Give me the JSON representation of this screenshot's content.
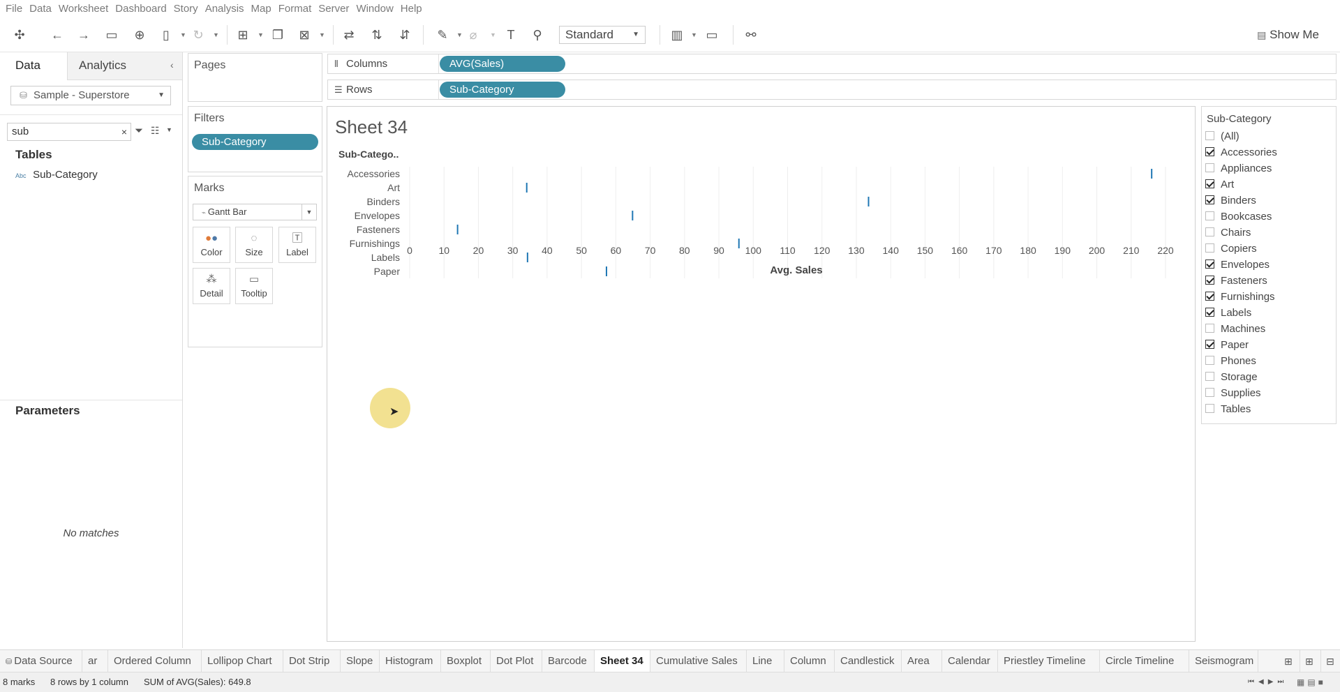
{
  "menu": [
    "File",
    "Data",
    "Worksheet",
    "Dashboard",
    "Story",
    "Analysis",
    "Map",
    "Format",
    "Server",
    "Window",
    "Help"
  ],
  "toolbar": {
    "fit": "Standard",
    "show_me": "Show Me"
  },
  "left_pane": {
    "tabs": [
      "Data",
      "Analytics"
    ],
    "datasource": "Sample - Superstore",
    "search_value": "sub",
    "tables_heading": "Tables",
    "fields": [
      {
        "type": "Abc",
        "name": "Sub-Category"
      }
    ],
    "parameters_heading": "Parameters",
    "no_matches": "No matches"
  },
  "cards": {
    "pages": "Pages",
    "filters": "Filters",
    "filter_pill": "Sub-Category",
    "marks": "Marks",
    "mark_type": "Gantt Bar",
    "mark_buttons": [
      "Color",
      "Size",
      "Label",
      "Detail",
      "Tooltip"
    ]
  },
  "shelves": {
    "columns_label": "Columns",
    "columns_pill": "AVG(Sales)",
    "rows_label": "Rows",
    "rows_pill": "Sub-Category"
  },
  "sheet_title": "Sheet 34",
  "chart_data": {
    "type": "gantt",
    "row_header": "Sub-Catego..",
    "categories": [
      "Accessories",
      "Art",
      "Binders",
      "Envelopes",
      "Fasteners",
      "Furnishings",
      "Labels",
      "Paper"
    ],
    "values": [
      215.97,
      34.07,
      133.56,
      64.87,
      13.94,
      95.83,
      34.3,
      57.28
    ],
    "xlabel": "Avg. Sales",
    "xlim": [
      0,
      225
    ],
    "xticks": [
      0,
      10,
      20,
      30,
      40,
      50,
      60,
      70,
      80,
      90,
      100,
      110,
      120,
      130,
      140,
      150,
      160,
      170,
      180,
      190,
      200,
      210,
      220
    ],
    "color": "#1f77b4"
  },
  "legend": {
    "title": "Sub-Category",
    "items": [
      {
        "label": "(All)",
        "checked": false
      },
      {
        "label": "Accessories",
        "checked": true
      },
      {
        "label": "Appliances",
        "checked": false
      },
      {
        "label": "Art",
        "checked": true
      },
      {
        "label": "Binders",
        "checked": true
      },
      {
        "label": "Bookcases",
        "checked": false
      },
      {
        "label": "Chairs",
        "checked": false
      },
      {
        "label": "Copiers",
        "checked": false
      },
      {
        "label": "Envelopes",
        "checked": true
      },
      {
        "label": "Fasteners",
        "checked": true
      },
      {
        "label": "Furnishings",
        "checked": true
      },
      {
        "label": "Labels",
        "checked": true
      },
      {
        "label": "Machines",
        "checked": false
      },
      {
        "label": "Paper",
        "checked": true
      },
      {
        "label": "Phones",
        "checked": false
      },
      {
        "label": "Storage",
        "checked": false
      },
      {
        "label": "Supplies",
        "checked": false
      },
      {
        "label": "Tables",
        "checked": false
      }
    ]
  },
  "tabs": [
    "Data Source",
    "ar",
    "Ordered Column",
    "Lollipop Chart",
    "Dot Strip",
    "Slope",
    "Histogram",
    "Boxplot",
    "Dot Plot",
    "Barcode",
    "Sheet 34",
    "Cumulative Sales",
    "Line",
    "Column",
    "Candlestick",
    "Area",
    "Calendar",
    "Priestley Timeline",
    "Circle Timeline",
    "Seismogram"
  ],
  "active_tab": "Sheet 34",
  "status": {
    "marks": "8 marks",
    "rows": "8 rows by 1 column",
    "sum": "SUM of AVG(Sales): 649.8"
  }
}
